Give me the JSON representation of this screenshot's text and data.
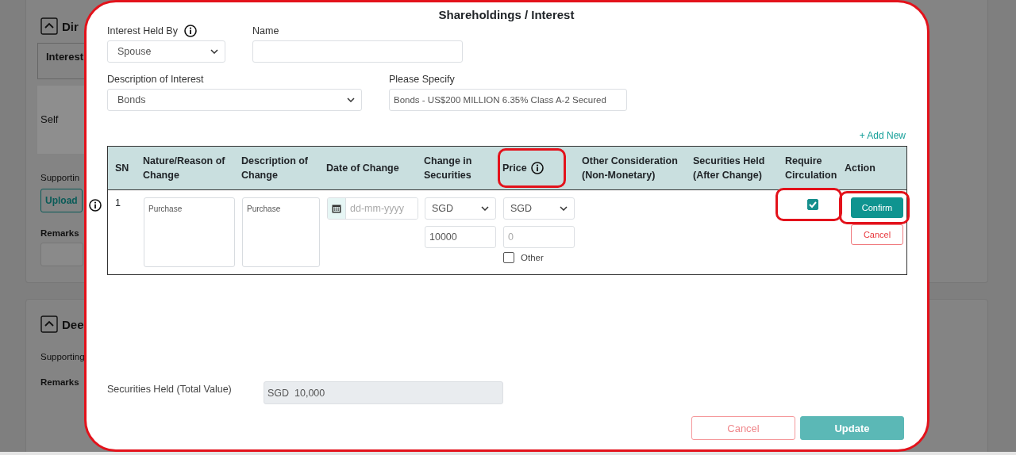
{
  "background_page": {
    "sections": [
      {
        "heading": "Dir",
        "inner_tab": "Interest",
        "inner_value": "Self",
        "supporting_label": "Supportin",
        "upload_button": "Upload",
        "remarks_label": "Remarks"
      },
      {
        "heading": "Dee",
        "supporting_label": "Supporting",
        "remarks_label": "Remarks"
      }
    ]
  },
  "modal": {
    "title": "Shareholdings / Interest",
    "highlighted": true,
    "fields": [
      {
        "kind": "select",
        "label": "Interest Held By",
        "info": true,
        "value": "Spouse"
      },
      {
        "kind": "input",
        "label": "Name"
      },
      {
        "kind": "select",
        "label": "Description of Interest",
        "value": "Bonds"
      },
      {
        "kind": "input",
        "label": "Please Specify",
        "value": "Bonds - US$200 MILLION 6.35% Class A-2 Secured"
      }
    ],
    "add_new": "+ Add New",
    "table": {
      "columns": [
        {
          "label": "SN"
        },
        {
          "label": "Nature/Reason of Change"
        },
        {
          "label": "Description of Change"
        },
        {
          "label": "Date of Change"
        },
        {
          "label": "Change in Securities"
        },
        {
          "label": "Price",
          "info": true,
          "highlighted": true
        },
        {
          "label": "Other Consideration (Non-Monetary)"
        },
        {
          "label": "Securities Held (After Change)"
        },
        {
          "label": "Require Circulation"
        },
        {
          "label": "Action"
        }
      ],
      "rows": [
        {
          "sn": "1",
          "nature": "Purchase",
          "description": "Purchase",
          "date_placeholder": "dd-mm-yyyy",
          "change_currency": "SGD",
          "change_amount": "10000",
          "price_currency": "SGD",
          "price_placeholder": "0",
          "other_label": "Other",
          "other_checked": false,
          "require_circulation": true,
          "circulation_highlighted": true,
          "actions": [
            {
              "label": "Confirm",
              "kind": "primary",
              "highlighted": true
            },
            {
              "label": "Cancel",
              "kind": "secondary"
            }
          ]
        }
      ]
    },
    "total": {
      "label": "Securities Held (Total Value)",
      "value": "SGD  10,000"
    },
    "buttons": [
      {
        "label": "Cancel",
        "kind": "secondary"
      },
      {
        "label": "Update",
        "kind": "primary"
      }
    ]
  }
}
